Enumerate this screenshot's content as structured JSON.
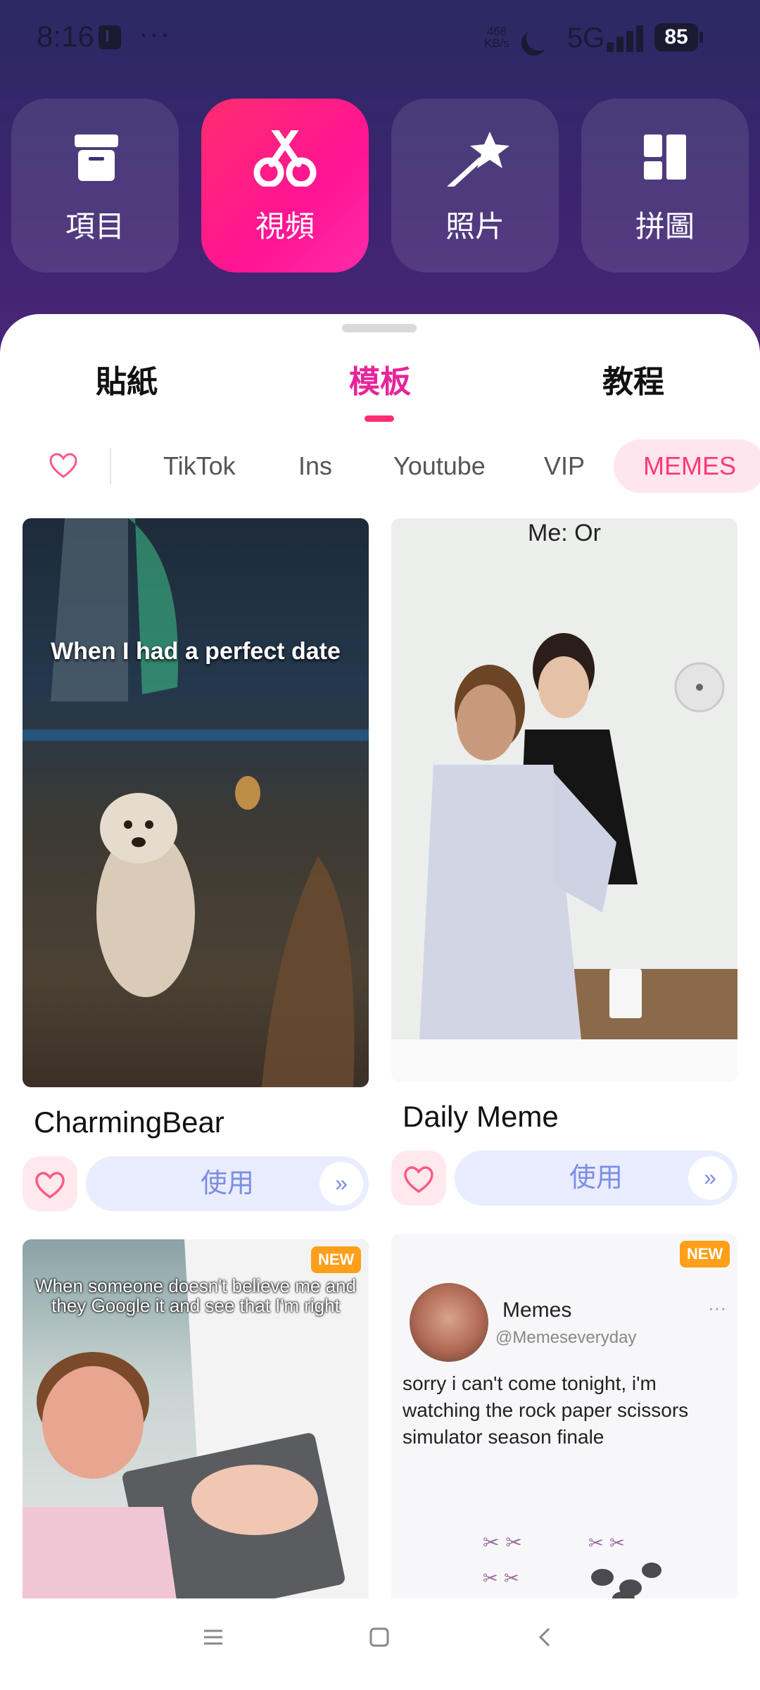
{
  "status_bar": {
    "time": "8:16",
    "more": "···",
    "speed_value": "468",
    "speed_unit": "KB/s",
    "network": "5G",
    "battery": "85"
  },
  "top_tiles": [
    {
      "label": "項目",
      "icon": "box-icon"
    },
    {
      "label": "視頻",
      "icon": "scissors-icon",
      "active": true
    },
    {
      "label": "照片",
      "icon": "magic-wand-icon"
    },
    {
      "label": "拼圖",
      "icon": "collage-icon"
    }
  ],
  "tabs": [
    {
      "label": "貼紙"
    },
    {
      "label": "模板",
      "active": true
    },
    {
      "label": "教程"
    }
  ],
  "chips": [
    "TikTok",
    "Ins",
    "Youtube",
    "VIP",
    "MEMES"
  ],
  "active_chip": "MEMES",
  "cards": [
    {
      "title": "CharmingBear",
      "image_text": "When I had a perfect date",
      "use_label": "使用",
      "go": "»"
    },
    {
      "title": "Daily Meme",
      "image_text": "Me: Or",
      "use_label": "使用",
      "go": "»"
    },
    {
      "badge": "NEW",
      "image_text": "When someone doesn't believe me and they Google it and see that I'm right"
    },
    {
      "badge": "NEW",
      "tweet_name": "Memes",
      "tweet_handle": "@Memeseveryday",
      "tweet_more": "···",
      "tweet_text": "sorry i can't come tonight, i'm watching the rock paper scissors simulator season finale"
    }
  ],
  "colors": {
    "accent": "#ff1493",
    "tab_active": "#e8249a",
    "use_button_bg": "#e9edff",
    "new_badge": "#ff9f1a"
  }
}
